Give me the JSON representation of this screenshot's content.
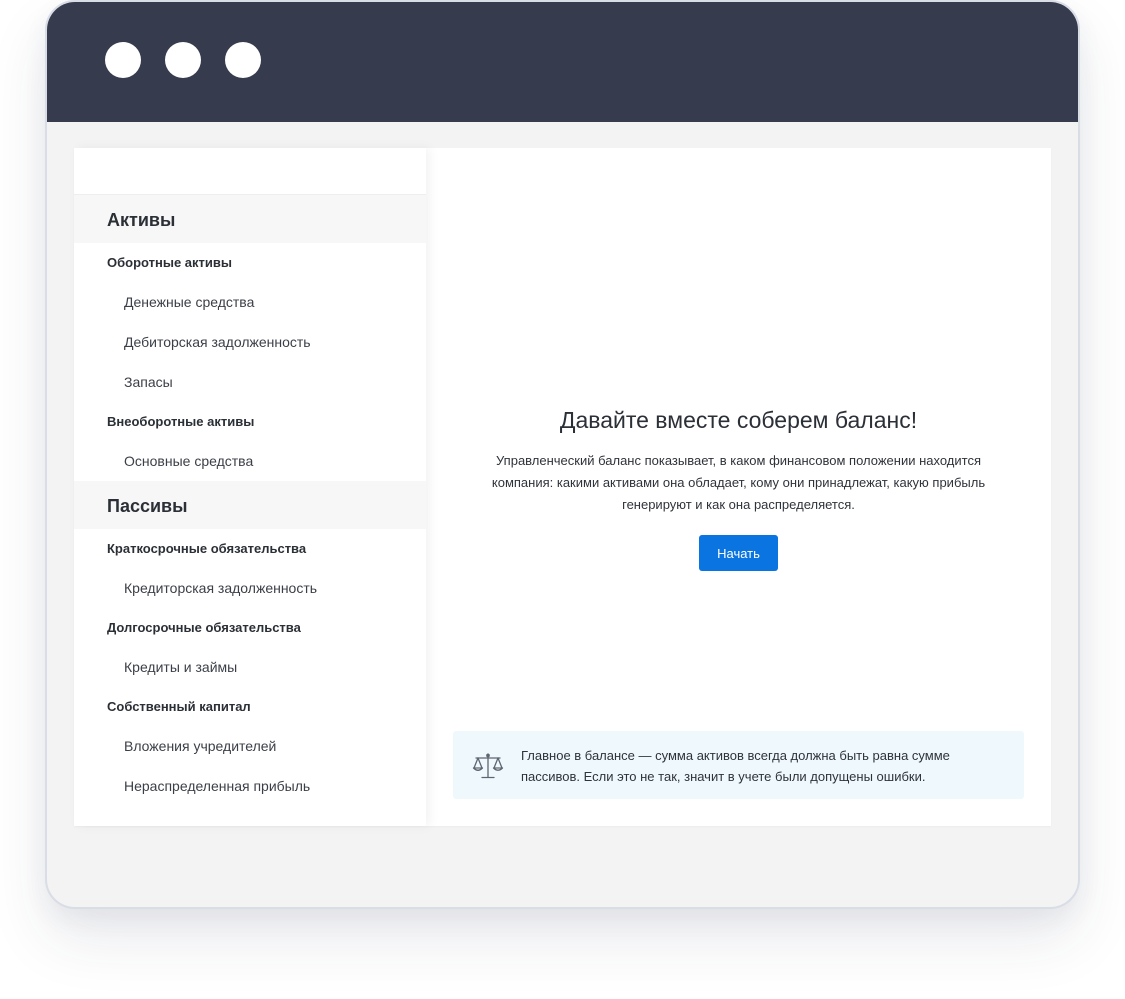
{
  "sidebar": {
    "assets": {
      "heading": "Активы",
      "groups": [
        {
          "label": "Оборотные активы",
          "items": [
            "Денежные средства",
            "Дебиторская задолженность",
            "Запасы"
          ]
        },
        {
          "label": "Внеоборотные активы",
          "items": [
            "Основные средства"
          ]
        }
      ]
    },
    "liabilities": {
      "heading": "Пассивы",
      "groups": [
        {
          "label": "Краткосрочные обязательства",
          "items": [
            "Кредиторская задолженность"
          ]
        },
        {
          "label": "Долгосрочные обязательства",
          "items": [
            "Кредиты и займы"
          ]
        },
        {
          "label": "Собственный капитал",
          "items": [
            "Вложения учредителей",
            "Нераспределенная прибыль"
          ]
        }
      ]
    }
  },
  "main": {
    "headline": "Давайте вместе соберем баланс!",
    "description": "Управленческий баланс показывает, в каком финансовом положении находится компания: какими активами она обладает, кому они принадлежат, какую прибыль генерируют и как она распределяется.",
    "start_label": "Начать",
    "tip": {
      "icon": "scales-icon",
      "text": "Главное в балансе — сумма активов всегда должна быть равна сумме пассивов. Если это не так, значит в учете были допущены ошибки."
    }
  },
  "colors": {
    "titlebar": "#363c4e",
    "accent": "#0a74e0",
    "tip_background": "#eff9fd"
  }
}
